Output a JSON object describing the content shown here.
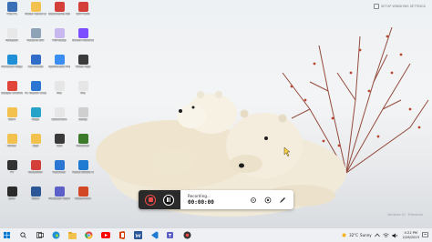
{
  "desktop": {
    "watermark_text": "SETUP WINDOWS SETTINGS",
    "os_watermark": [
      "Windows 10",
      "Enterprise"
    ],
    "icons": [
      {
        "id": "this-pc",
        "label": "This PC",
        "color": "#3b6fb6"
      },
      {
        "id": "fix-local",
        "label": "Folder name Computer",
        "color": "#f2c14e"
      },
      {
        "id": "file-2",
        "label": "Documents RECORD",
        "color": "#d43f3a"
      },
      {
        "id": "file-3",
        "label": "CAPTURE",
        "color": "#d43f3a"
      },
      {
        "id": "notepad",
        "label": "Notepad",
        "color": "#e8e8e8"
      },
      {
        "id": "recycle",
        "label": "Recycle Bin",
        "color": "#8fa3b8"
      },
      {
        "id": "pdf-app",
        "label": "PDFsetup",
        "color": "#c9b7f0"
      },
      {
        "id": "screen-rec",
        "label": "Screen Recorder",
        "color": "#7c4dff"
      },
      {
        "id": "edge",
        "label": "Microsoft Edge",
        "color": "#1f8fd6"
      },
      {
        "id": "cert",
        "label": "Certificate",
        "color": "#2f6dc9"
      },
      {
        "id": "folder-a",
        "label": "Apowersoft Free Screen",
        "color": "#3a8ef2"
      },
      {
        "id": "video-app",
        "label": "Video App",
        "color": "#3a3a3a"
      },
      {
        "id": "chrome",
        "label": "Google Chrome",
        "color": "#e1453a"
      },
      {
        "id": "pc-health",
        "label": "PC Health Check",
        "color": "#2b76d2"
      },
      {
        "id": "file-b",
        "label": "File",
        "color": "#e6e6e6"
      },
      {
        "id": "file-c",
        "label": "File",
        "color": "#e6e6e6"
      },
      {
        "id": "folder-b",
        "label": "Work",
        "color": "#f2c14e"
      },
      {
        "id": "edge-2",
        "label": "Edge",
        "color": "#27a3c9"
      },
      {
        "id": "file-d",
        "label": "Document",
        "color": "#e6e6e6"
      },
      {
        "id": "file-e",
        "label": "Setup",
        "color": "#cfcfcf"
      },
      {
        "id": "folder-c",
        "label": "Folder",
        "color": "#f2c14e"
      },
      {
        "id": "app-x",
        "label": "App",
        "color": "#f2c14e"
      },
      {
        "id": "app-y",
        "label": "Tool",
        "color": "#3a3a3a"
      },
      {
        "id": "app-z",
        "label": "Recorder",
        "color": "#3c7a2b"
      },
      {
        "id": "tv",
        "label": "TV",
        "color": "#333"
      },
      {
        "id": "ext",
        "label": "Extension",
        "color": "#d43f3a"
      },
      {
        "id": "recorder",
        "label": "Recorder",
        "color": "#2b76d2"
      },
      {
        "id": "code",
        "label": "Visual Studio Code",
        "color": "#1f7ad1"
      },
      {
        "id": "java",
        "label": "java",
        "color": "#2b2b2b"
      },
      {
        "id": "word",
        "label": "Word",
        "color": "#2b5797"
      },
      {
        "id": "teams",
        "label": "Microsoft Teams",
        "color": "#5b5fc7"
      },
      {
        "id": "ppt",
        "label": "PowerPoint",
        "color": "#d24726"
      }
    ]
  },
  "recorder": {
    "status": "Recording...",
    "time": "00:00:00"
  },
  "taskbar": {
    "weather_temp": "32°C",
    "weather_text": "Sunny",
    "time": "4:22 PM",
    "date": "2/28/2023",
    "colors": {
      "start": "#0078d4",
      "edge": "#1f8fd6",
      "chrome": "#e1453a",
      "youtube": "#ff0000",
      "office": "#d83b01",
      "word": "#2b579a",
      "vscode": "#1f7ad1",
      "teams": "#5b5fc7",
      "files": "#f2c14e"
    }
  }
}
